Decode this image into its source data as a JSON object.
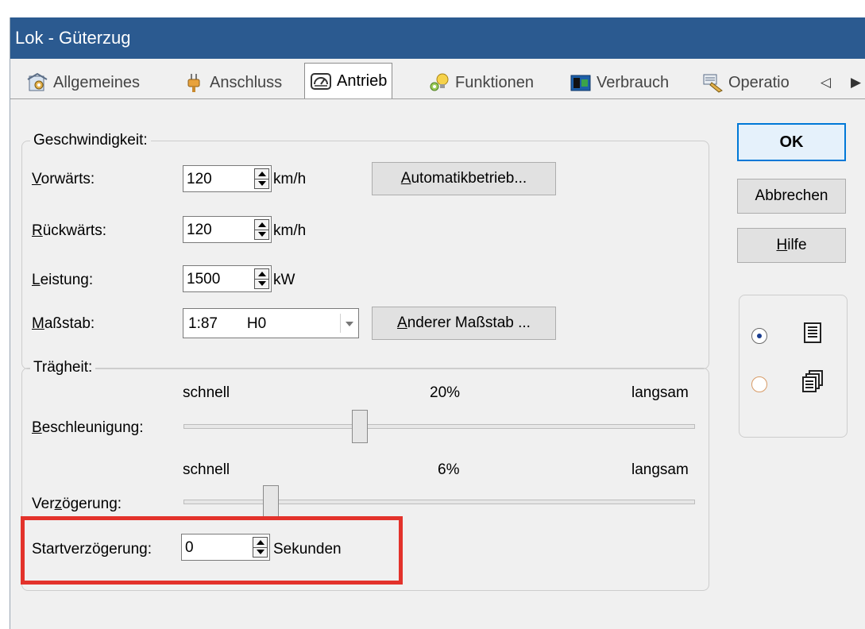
{
  "window": {
    "title": "Lok - Güterzug"
  },
  "tabs": [
    {
      "label": "Allgemeines",
      "icon": "gear-document-icon",
      "active": false
    },
    {
      "label": "Anschluss",
      "icon": "plug-icon",
      "active": false
    },
    {
      "label": "Antrieb",
      "icon": "speedometer-icon",
      "active": true
    },
    {
      "label": "Funktionen",
      "icon": "lightbulb-icon",
      "active": false
    },
    {
      "label": "Verbrauch",
      "icon": "fuel-icon",
      "active": false
    },
    {
      "label": "Operatio",
      "icon": "operation-icon",
      "active": false
    }
  ],
  "tab_scroll": {
    "left": "◁",
    "right": "▶"
  },
  "speed_group": {
    "title": "Geschwindigkeit:",
    "forward": {
      "label_u": "V",
      "label_rest": "orwärts:",
      "value": "120",
      "unit": "km/h"
    },
    "backward": {
      "label_u": "R",
      "label_rest": "ückwärts:",
      "value": "120",
      "unit": "km/h"
    },
    "power": {
      "label_u": "L",
      "label_rest": "eistung:",
      "value": "1500",
      "unit": "kW"
    },
    "scale": {
      "label_u": "M",
      "label_rest": "aßstab:",
      "value": "1:87       H0"
    },
    "auto_button": {
      "label_u": "A",
      "label_rest": "utomatikbetrieb..."
    },
    "other_scale_button": {
      "label_u": "A",
      "label_rest": "nderer Maßstab ..."
    }
  },
  "inertia_group": {
    "title": "Trägheit:",
    "acceleration": {
      "label_u": "B",
      "label_rest": "eschleunigung:",
      "left": "schnell",
      "right": "langsam",
      "percent": "20%",
      "value": 0.34
    },
    "deceleration": {
      "label_pre": "Ver",
      "label_u": "z",
      "label_rest": "ögerung:",
      "left": "schnell",
      "right": "langsam",
      "percent": "6%",
      "value": 0.16
    },
    "start_delay": {
      "label": "Startverzögerung:",
      "value": "0",
      "unit": "Sekunden"
    }
  },
  "buttons": {
    "ok": "OK",
    "cancel": "Abbrechen",
    "help_u": "H",
    "help_rest": "ilfe"
  },
  "view_options": [
    {
      "icon": "list-view-icon",
      "checked": true
    },
    {
      "icon": "cascade-view-icon",
      "checked": false
    }
  ],
  "colors": {
    "titlebar": "#2b5a90",
    "highlight": "#e3322b",
    "default_button_border": "#0078d7"
  }
}
